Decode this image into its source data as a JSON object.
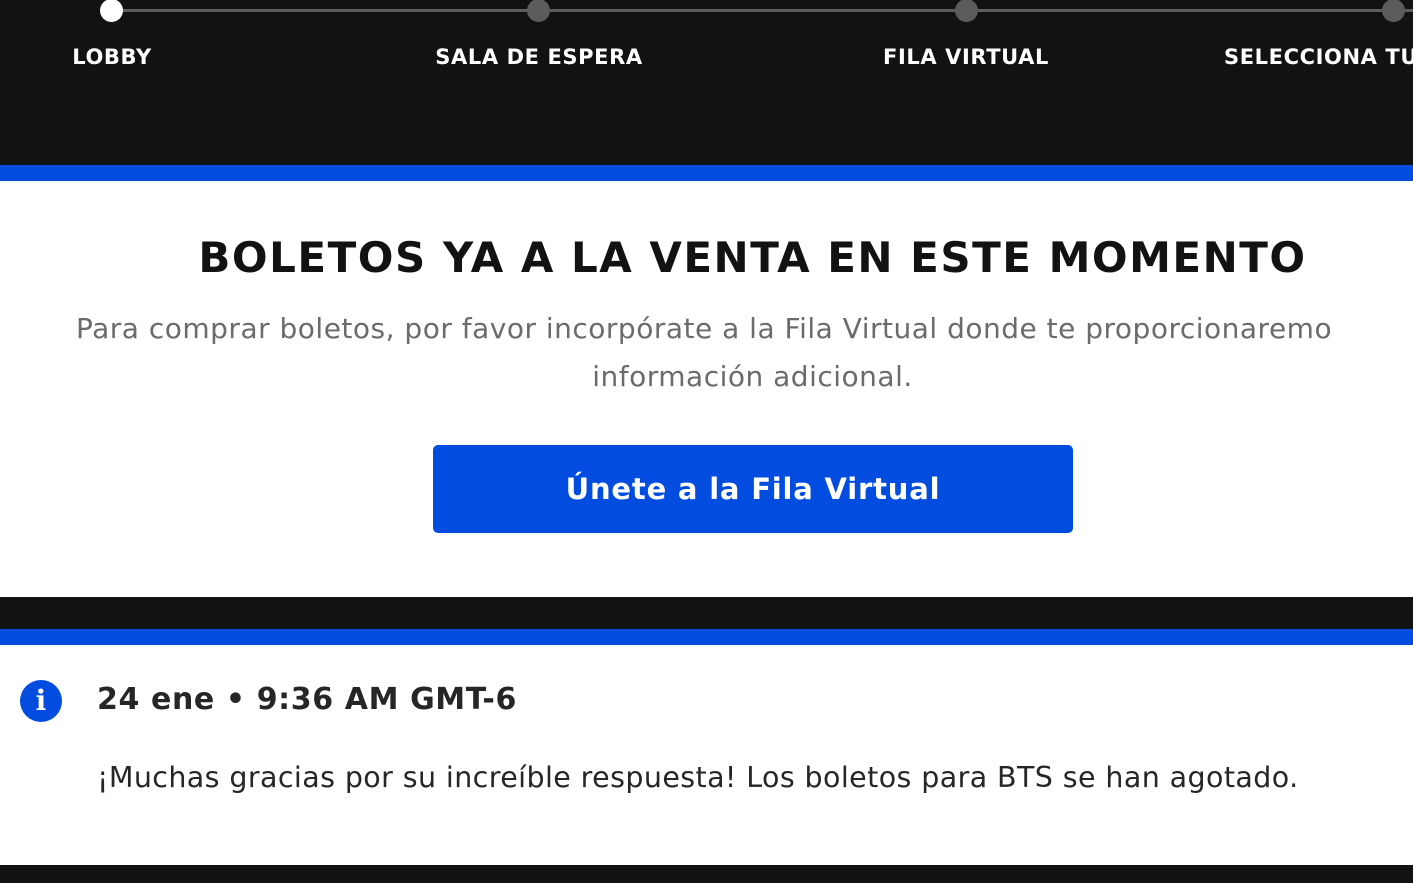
{
  "progress": {
    "steps": [
      {
        "label": "LOBBY",
        "active": true
      },
      {
        "label": "SALA DE ESPERA",
        "active": false
      },
      {
        "label": "FILA VIRTUAL",
        "active": false
      },
      {
        "label": "SELECCIONA TU",
        "active": false
      }
    ]
  },
  "sale": {
    "title": "BOLETOS YA A LA VENTA EN ESTE MOMENTO",
    "description_line1": "Para comprar boletos, por favor incorpórate a la Fila Virtual donde te proporcionaremo",
    "description_line2": "información adicional.",
    "button_label": "Únete a la Fila Virtual"
  },
  "notice": {
    "icon": "info-icon",
    "icon_glyph": "i",
    "date": "24 ene • 9:36 AM GMT-6",
    "message": "¡Muchas gracias por su increíble respuesta! Los boletos para BTS se han agotado."
  },
  "colors": {
    "brand_blue": "#024ddf",
    "dark": "#121212",
    "step_inactive": "#5c5c5c"
  }
}
